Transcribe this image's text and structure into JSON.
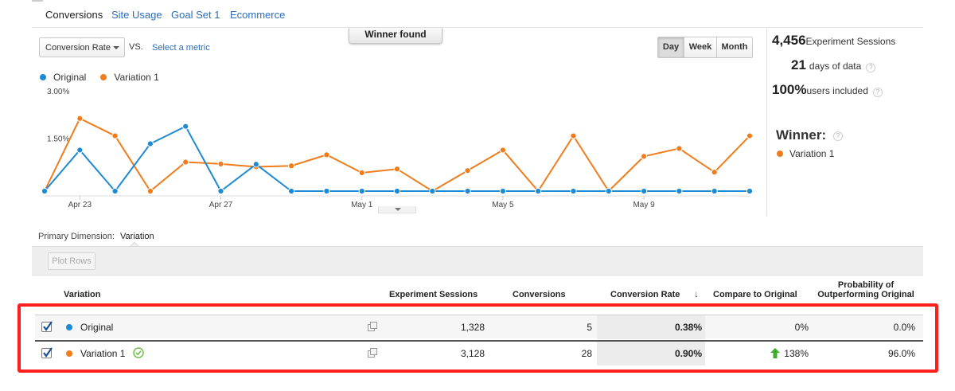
{
  "tabs": [
    "Conversions",
    "Site Usage",
    "Goal Set 1",
    "Ecommerce"
  ],
  "controls": {
    "metric": "Conversion Rate",
    "vs": "VS.",
    "select_metric": "Select a metric",
    "winner_found": "Winner found",
    "periods": [
      "Day",
      "Week",
      "Month"
    ],
    "active_period": "Day"
  },
  "legend": [
    {
      "name": "Original",
      "color": "#1f8ad4"
    },
    {
      "name": "Variation 1",
      "color": "#f07c1c"
    }
  ],
  "chart_data": {
    "type": "line",
    "y_ticks": [
      "3.00%",
      "1.50%"
    ],
    "x_tick_labels": [
      "Apr 23",
      "Apr 27",
      "May 1",
      "May 5",
      "May 9"
    ],
    "x_tick_indices": [
      1,
      5,
      9,
      13,
      17
    ],
    "ylim": [
      0,
      3.0
    ],
    "series": [
      {
        "name": "Original",
        "color": "#1f8ad4",
        "values": [
          0,
          1.3,
          0,
          1.5,
          2.05,
          0,
          0.85,
          0,
          0,
          0,
          0,
          0,
          0,
          0,
          0,
          0,
          0,
          0,
          0,
          0,
          0
        ]
      },
      {
        "name": "Variation 1",
        "color": "#f07c1c",
        "values": [
          0,
          2.3,
          1.75,
          0,
          0.92,
          0.86,
          0.77,
          0.8,
          1.15,
          0.58,
          0.7,
          0,
          0.65,
          1.3,
          0,
          1.75,
          0,
          1.1,
          1.35,
          0.6,
          1.75
        ]
      }
    ],
    "grid": false
  },
  "stats": {
    "sessions_value": "4,456",
    "sessions_label": "Experiment Sessions",
    "days_value": "21",
    "days_label": "days of data",
    "users_value": "100%",
    "users_label": "users included",
    "winner_title": "Winner:",
    "winner_name": "Variation 1",
    "winner_color": "#f07c1c"
  },
  "dimension": {
    "label": "Primary Dimension:",
    "value": "Variation"
  },
  "toolbar": {
    "plot_rows": "Plot Rows"
  },
  "table": {
    "headers": {
      "variation": "Variation",
      "sessions": "Experiment Sessions",
      "conversions": "Conversions",
      "rate": "Conversion Rate",
      "compare": "Compare to Original",
      "prob": "Probability of Outperforming Original"
    },
    "rows": [
      {
        "name": "Original",
        "color": "#1f8ad4",
        "sessions": "1,328",
        "conversions": "5",
        "rate": "0.38%",
        "compare": "0%",
        "prob": "0.0%"
      },
      {
        "name": "Variation 1",
        "color": "#f07c1c",
        "sessions": "3,128",
        "conversions": "28",
        "rate": "0.90%",
        "compare": "138%",
        "prob": "96.0%"
      }
    ]
  },
  "colors": {
    "link": "#2a6ebb",
    "highlight": "#ff1f1f",
    "up_arrow": "#3fae2a"
  }
}
